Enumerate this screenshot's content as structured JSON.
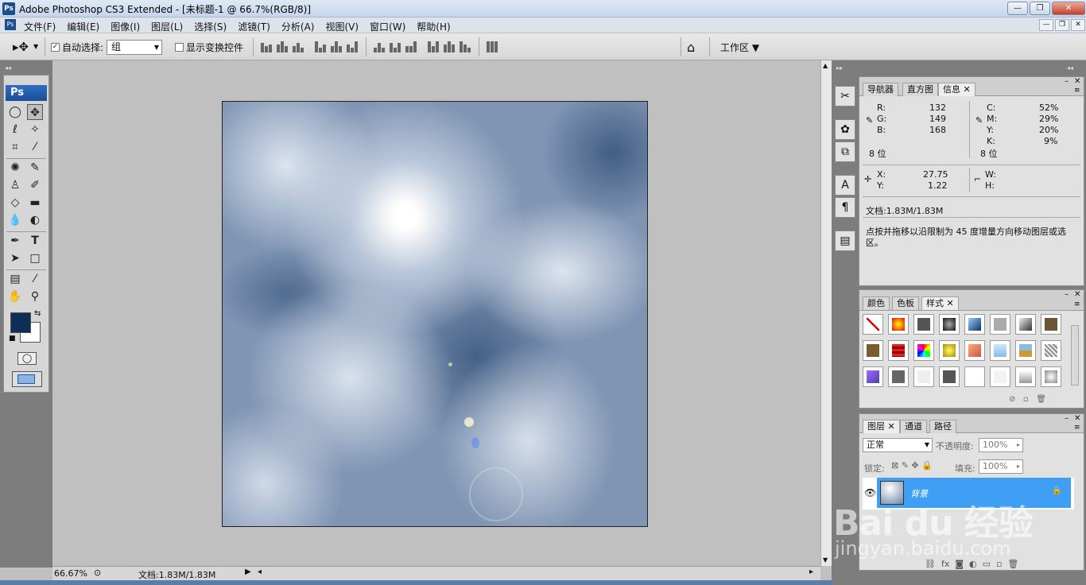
{
  "window": {
    "title": "Adobe Photoshop CS3 Extended - [未标题-1 @ 66.7%(RGB/8)]",
    "app_icon_label": "Ps",
    "minimize": "—",
    "maximize": "❐",
    "close": "✕"
  },
  "menu": [
    "文件(F)",
    "编辑(E)",
    "图像(I)",
    "图层(L)",
    "选择(S)",
    "滤镜(T)",
    "分析(A)",
    "视图(V)",
    "窗口(W)",
    "帮助(H)"
  ],
  "options": {
    "auto_select_label": "自动选择:",
    "auto_select_value": "组",
    "show_transform_label": "显示变换控件",
    "workspace_label": "工作区",
    "auto_select_checked": "✓"
  },
  "toolbox": {
    "logo": "Ps"
  },
  "status": {
    "zoom": "66.67%",
    "doc": "文档:1.83M/1.83M"
  },
  "info_panel": {
    "tabs": [
      "导航器",
      "直方图",
      "信息"
    ],
    "rgb": {
      "R": "132",
      "G": "149",
      "B": "168"
    },
    "cmyk": {
      "C": "52%",
      "M": "29%",
      "Y": "20%",
      "K": "9%"
    },
    "bits_left": "8 位",
    "bits_right": "8 位",
    "xy": {
      "X": "27.75",
      "Y": "1.22"
    },
    "wh": {
      "W": "",
      "H": ""
    },
    "doc": "文档:1.83M/1.83M",
    "hint": "点按并拖移以沿限制为 45 度增量方向移动图层或选区。",
    "labels": {
      "R": "R:",
      "G": "G:",
      "B": "B:",
      "C": "C:",
      "M": "M:",
      "Y": "Y:",
      "K": "K:",
      "X": "X:",
      "Yc": "Y:",
      "W": "W:",
      "H": "H:"
    }
  },
  "styles_panel": {
    "tabs": [
      "颜色",
      "色板",
      "样式"
    ]
  },
  "layers_panel": {
    "tabs": [
      "图层",
      "通道",
      "路径"
    ],
    "blend_mode": "正常",
    "opacity_label": "不透明度:",
    "opacity_value": "100%",
    "lock_label": "锁定:",
    "fill_label": "填充:",
    "fill_value": "100%",
    "layer_name": "背景"
  },
  "watermark": {
    "logo": "Bai du 经验",
    "url": "jingyan.baidu.com"
  },
  "colors": {
    "accent_layer": "#3f9ff5",
    "foreground": "#0f2e57",
    "background": "#ffffff"
  }
}
